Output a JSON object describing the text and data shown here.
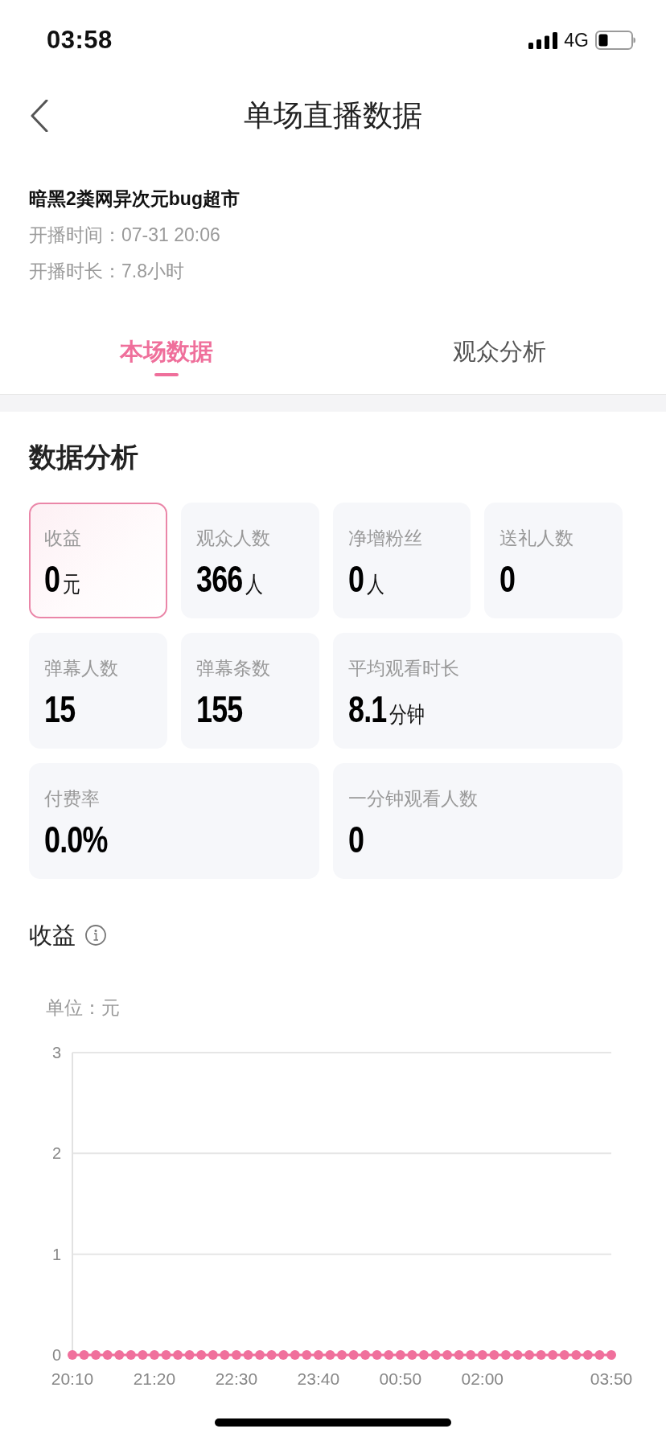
{
  "status_bar": {
    "time": "03:58",
    "network": "4G"
  },
  "header": {
    "title": "单场直播数据"
  },
  "stream": {
    "name": "暗黑2粪网异次元bug超市",
    "start_time": "开播时间：07-31 20:06",
    "duration": "开播时长：7.8小时"
  },
  "tabs": [
    {
      "label": "本场数据",
      "selected": true
    },
    {
      "label": "观众分析",
      "selected": false
    }
  ],
  "analysis": {
    "title": "数据分析",
    "cards": [
      {
        "label": "收益",
        "value": "0",
        "unit": "元",
        "selected": true
      },
      {
        "label": "观众人数",
        "value": "366",
        "unit": "人",
        "selected": false
      },
      {
        "label": "净增粉丝",
        "value": "0",
        "unit": "人",
        "selected": false
      },
      {
        "label": "送礼人数",
        "value": "0",
        "selected": false
      },
      {
        "label": "弹幕人数",
        "value": "15",
        "selected": false
      },
      {
        "label": "弹幕条数",
        "value": "155",
        "selected": false
      },
      {
        "label": "平均观看时长",
        "value": "8.1",
        "unit": "分钟",
        "selected": false
      },
      {
        "label": "付费率",
        "value": "0.0%",
        "selected": false
      },
      {
        "label": "一分钟观看人数",
        "value": "0",
        "selected": false
      }
    ]
  },
  "revenue_chart": {
    "chart_data": {
      "type": "line",
      "title": "收益",
      "ylabel": "单位：元",
      "categories": [
        "20:10",
        null,
        null,
        null,
        null,
        null,
        null,
        "21:20",
        null,
        null,
        null,
        null,
        null,
        null,
        "22:30",
        null,
        null,
        null,
        null,
        null,
        null,
        "23:40",
        null,
        null,
        null,
        null,
        null,
        null,
        "00:50",
        null,
        null,
        null,
        null,
        null,
        null,
        "02:00",
        null,
        null,
        null,
        null,
        null,
        null,
        null,
        null,
        null,
        null,
        "03:50"
      ],
      "ylim": [
        0,
        3
      ],
      "yticks": [
        0,
        1,
        2,
        3
      ],
      "series": [
        {
          "color": "#f0709c",
          "marker": "circle",
          "values": [
            0,
            0,
            0,
            0,
            0,
            0,
            0,
            0,
            0,
            0,
            0,
            0,
            0,
            0,
            0,
            0,
            0,
            0,
            0,
            0,
            0,
            0,
            0,
            0,
            0,
            0,
            0,
            0,
            0,
            0,
            0,
            0,
            0,
            0,
            0,
            0,
            0,
            0,
            0,
            0,
            0,
            0,
            0,
            0,
            0,
            0,
            0
          ]
        }
      ]
    }
  }
}
